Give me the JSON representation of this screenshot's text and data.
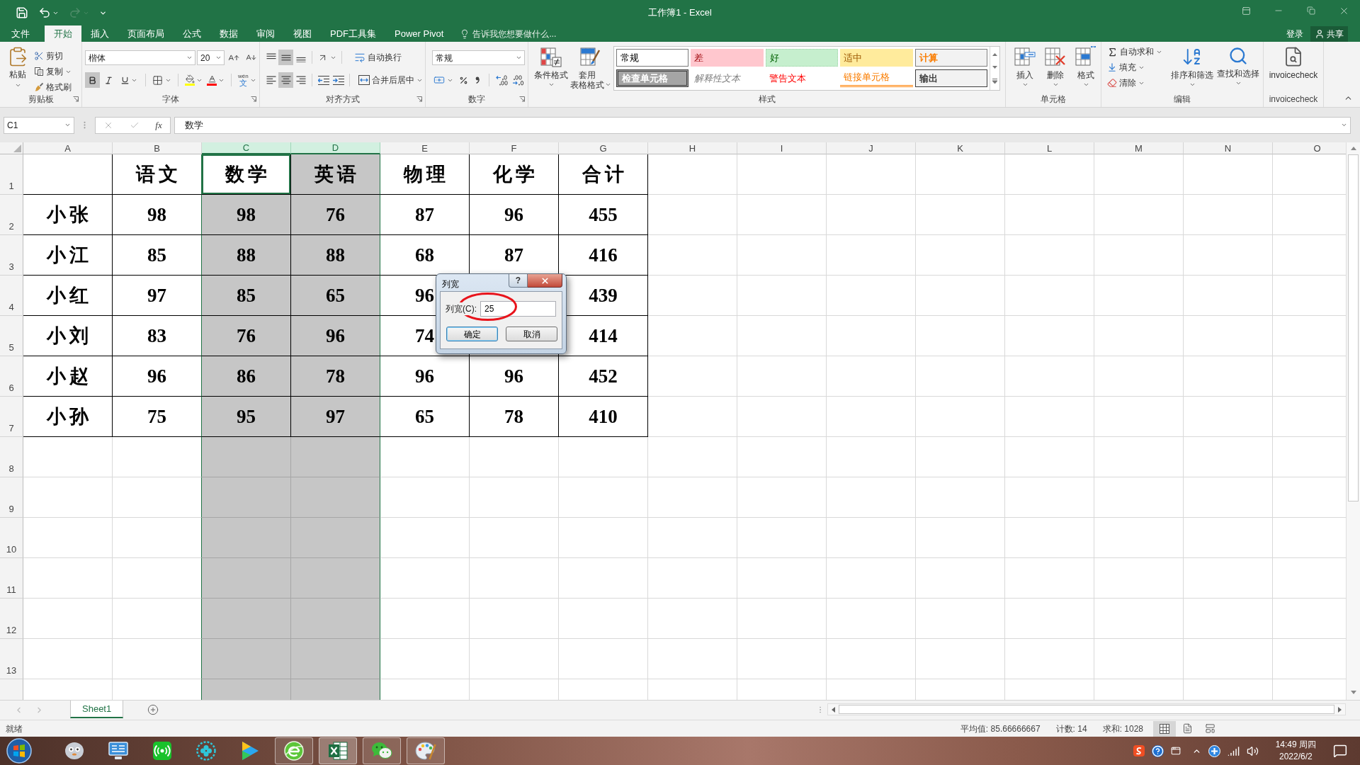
{
  "title_bar": {
    "title": "工作簿1 - Excel"
  },
  "quick_access": [
    {
      "kind": "save",
      "disabled": false
    },
    {
      "kind": "undo",
      "disabled": false
    },
    {
      "kind": "redo",
      "disabled": true
    },
    {
      "kind": "customize",
      "disabled": false
    }
  ],
  "menu_tabs": [
    {
      "label": "文件",
      "selected": false
    },
    {
      "label": "开始",
      "selected": true
    },
    {
      "label": "插入",
      "selected": false
    },
    {
      "label": "页面布局",
      "selected": false
    },
    {
      "label": "公式",
      "selected": false
    },
    {
      "label": "数据",
      "selected": false
    },
    {
      "label": "审阅",
      "selected": false
    },
    {
      "label": "视图",
      "selected": false
    },
    {
      "label": "PDF工具集",
      "selected": false
    },
    {
      "label": "Power Pivot",
      "selected": false
    }
  ],
  "tell_me": {
    "placeholder": "告诉我您想要做什么..."
  },
  "account": {
    "sign_in": "登录",
    "share": "共享"
  },
  "ribbon": {
    "clipboard": {
      "label": "剪贴板",
      "paste": "粘贴",
      "cut": "剪切",
      "copy": "复制",
      "format_painter": "格式刷"
    },
    "font": {
      "label": "字体",
      "font_name": "楷体",
      "font_size": "20",
      "bold": true,
      "italic": false,
      "underline": false,
      "phonetic_pinyin": "wén",
      "phonetic_char": "文"
    },
    "alignment": {
      "label": "对齐方式",
      "vertical_buttons": [
        {
          "kind": "top",
          "selected": false
        },
        {
          "kind": "middle",
          "selected": true
        },
        {
          "kind": "bottom",
          "selected": false
        }
      ],
      "horizontal_buttons": [
        {
          "kind": "left",
          "selected": false
        },
        {
          "kind": "center",
          "selected": true
        },
        {
          "kind": "right",
          "selected": false
        }
      ],
      "wrap_text": "自动换行",
      "merge_center": "合并后居中"
    },
    "number": {
      "label": "数字",
      "format": "常规"
    },
    "styles": {
      "label": "样式",
      "conditional_formatting": "条件格式",
      "format_as_table": [
        "套用",
        "表格格式"
      ],
      "gallery": [
        {
          "label": "常规",
          "kind": "normal"
        },
        {
          "label": "差",
          "kind": "bad"
        },
        {
          "label": "好",
          "kind": "good"
        },
        {
          "label": "适中",
          "kind": "neutral"
        },
        {
          "label": "计算",
          "kind": "calculation"
        },
        {
          "label": "检查单元格",
          "kind": "check_cell"
        },
        {
          "label": "解释性文本",
          "kind": "explanatory"
        },
        {
          "label": "警告文本",
          "kind": "warning"
        },
        {
          "label": "链接单元格",
          "kind": "linked_cell"
        },
        {
          "label": "输出",
          "kind": "output"
        }
      ]
    },
    "cells": {
      "label": "单元格",
      "insert": "插入",
      "delete": "删除",
      "format": "格式"
    },
    "editing": {
      "label": "编辑",
      "autosum": "自动求和",
      "fill": "填充",
      "clear": "清除",
      "sort_filter": "排序和筛选",
      "find_select": "查找和选择"
    },
    "addin": {
      "label": "invoicecheck",
      "button": "invoicecheck"
    }
  },
  "formula_bar": {
    "name_box": "C1",
    "function_button": "fx",
    "formula": "数学"
  },
  "sheet": {
    "columns": [
      {
        "label": "A",
        "selected": false
      },
      {
        "label": "B",
        "selected": false
      },
      {
        "label": "C",
        "selected": true
      },
      {
        "label": "D",
        "selected": true
      },
      {
        "label": "E",
        "selected": false
      },
      {
        "label": "F",
        "selected": false
      },
      {
        "label": "G",
        "selected": false
      },
      {
        "label": "H",
        "selected": false
      },
      {
        "label": "I",
        "selected": false
      },
      {
        "label": "J",
        "selected": false
      },
      {
        "label": "K",
        "selected": false
      },
      {
        "label": "L",
        "selected": false
      },
      {
        "label": "M",
        "selected": false
      },
      {
        "label": "N",
        "selected": false
      },
      {
        "label": "O",
        "selected": false
      }
    ],
    "row_headers": [
      "1",
      "2",
      "3",
      "4",
      "5",
      "6",
      "7",
      "8",
      "9",
      "10",
      "11",
      "12",
      "13"
    ],
    "header_cells": [
      {
        "text": "语文",
        "active": false
      },
      {
        "text": "数学",
        "active": true
      },
      {
        "text": "英语",
        "active": false
      },
      {
        "text": "物理",
        "active": false
      },
      {
        "text": "化学",
        "active": false
      },
      {
        "text": "合计",
        "active": false
      }
    ],
    "rows": [
      {
        "name": "小张",
        "chinese": "98",
        "math": "98",
        "english": "76",
        "physics": "87",
        "chemistry": "96",
        "total": "455"
      },
      {
        "name": "小江",
        "chinese": "85",
        "math": "88",
        "english": "88",
        "physics": "68",
        "chemistry": "87",
        "total": "416"
      },
      {
        "name": "小红",
        "chinese": "97",
        "math": "85",
        "english": "65",
        "physics": "96",
        "total": "439"
      },
      {
        "name": "小刘",
        "chinese": "83",
        "math": "76",
        "english": "96",
        "physics": "74",
        "total": "414"
      },
      {
        "name": "小赵",
        "chinese": "96",
        "math": "86",
        "english": "78",
        "physics": "96",
        "chemistry": "96",
        "total": "452"
      },
      {
        "name": "小孙",
        "chinese": "75",
        "math": "95",
        "english": "97",
        "physics": "65",
        "chemistry": "78",
        "total": "410"
      }
    ]
  },
  "dialog": {
    "title": "列宽",
    "help_button": "?",
    "field_label": "列宽(C):",
    "value": "25",
    "buttons": [
      {
        "label": "确定",
        "default": true
      },
      {
        "label": "取消",
        "default": false
      }
    ]
  },
  "sheet_tabs": [
    {
      "label": "Sheet1",
      "selected": true
    }
  ],
  "status_bar": {
    "status": "就绪",
    "average": "平均值: 85.66666667",
    "count": "计数: 14",
    "sum": "求和: 1028",
    "views": [
      {
        "kind": "normal",
        "selected": true
      },
      {
        "kind": "page_layout",
        "selected": false
      },
      {
        "kind": "page_break",
        "selected": false
      }
    ]
  },
  "taskbar": {
    "apps": [
      {
        "kind": "mascot",
        "running": false,
        "selected": false
      },
      {
        "kind": "monitor",
        "running": false,
        "selected": false
      },
      {
        "kind": "broadcast",
        "running": false,
        "selected": false
      },
      {
        "kind": "clover",
        "running": false,
        "selected": false
      },
      {
        "kind": "play",
        "running": false,
        "selected": false
      },
      {
        "kind": "globe",
        "running": true,
        "selected": false
      },
      {
        "kind": "spreadsheet",
        "running": true,
        "selected": true
      },
      {
        "kind": "chat",
        "running": true,
        "selected": false
      },
      {
        "kind": "palette",
        "running": true,
        "selected": false
      }
    ],
    "clock": {
      "time": "14:49 周四",
      "date": "2022/6/2"
    }
  }
}
